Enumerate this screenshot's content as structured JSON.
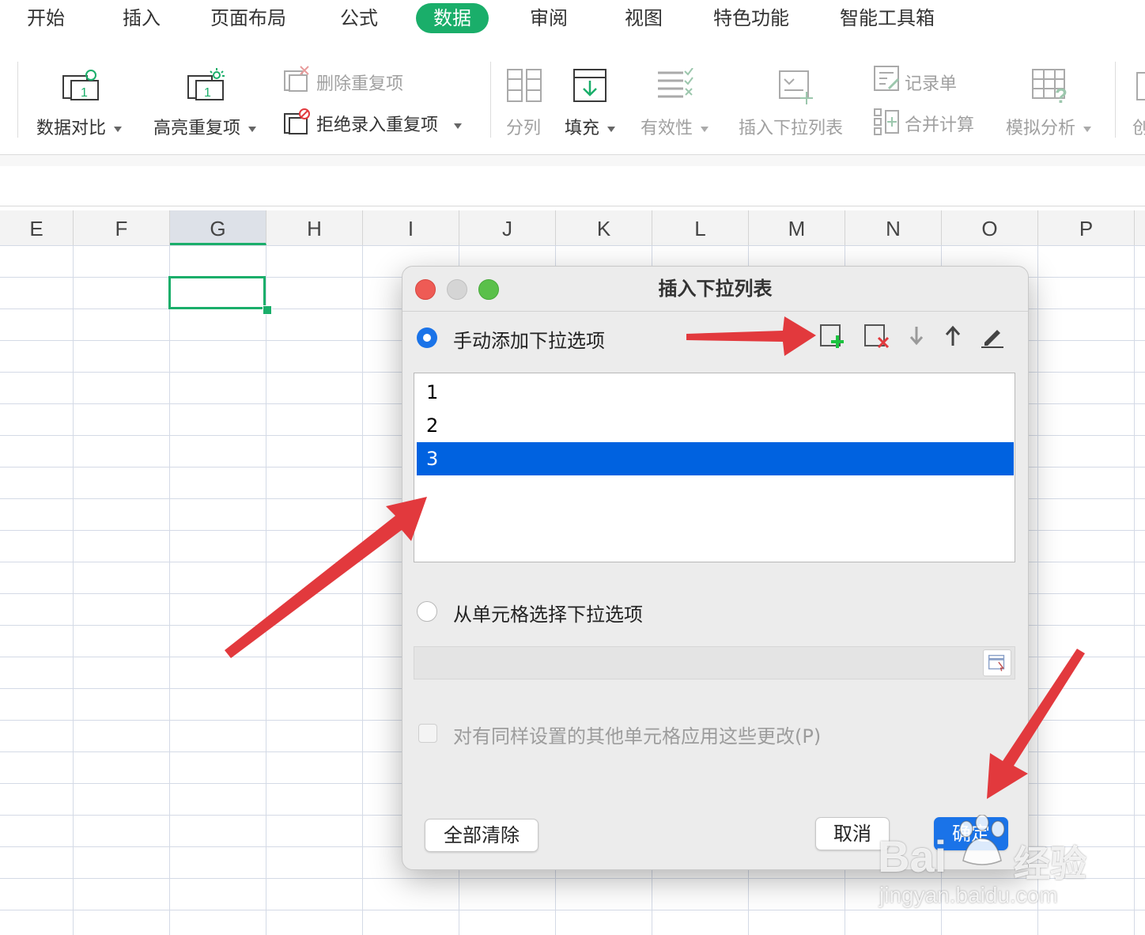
{
  "menu": {
    "tabs": [
      "开始",
      "插入",
      "页面布局",
      "公式",
      "数据",
      "审阅",
      "视图",
      "特色功能",
      "智能工具箱"
    ],
    "active": "数据"
  },
  "ribbon": {
    "data_compare": "数据对比",
    "highlight_dup": "高亮重复项",
    "delete_dup": "删除重复项",
    "reject_dup": "拒绝录入重复项",
    "split_col": "分列",
    "fill": "填充",
    "validity": "有效性",
    "insert_dropdown": "插入下拉列表",
    "record_sheet": "记录单",
    "merge_calc": "合并计算",
    "what_if": "模拟分析",
    "cut_off": "创"
  },
  "sheet": {
    "columns": [
      "E",
      "F",
      "G",
      "H",
      "I",
      "J",
      "K",
      "L",
      "M",
      "N",
      "O",
      "P"
    ],
    "selected_column": "G"
  },
  "dialog": {
    "title": "插入下拉列表",
    "manual_option": "手动添加下拉选项",
    "items": [
      "1",
      "2",
      "3"
    ],
    "selected_item": "3",
    "cell_option": "从单元格选择下拉选项",
    "apply_all": "对有同样设置的其他单元格应用这些更改(P)",
    "clear_all": "全部清除",
    "cancel": "取消",
    "ok": "确定"
  },
  "watermark": {
    "brand": "Bai",
    "brand2": "经验",
    "url": "jingyan.baidu.com"
  },
  "colors": {
    "accent_green": "#1aae6a",
    "selection_blue": "#0062e0",
    "arrow_red": "#e2393d"
  }
}
